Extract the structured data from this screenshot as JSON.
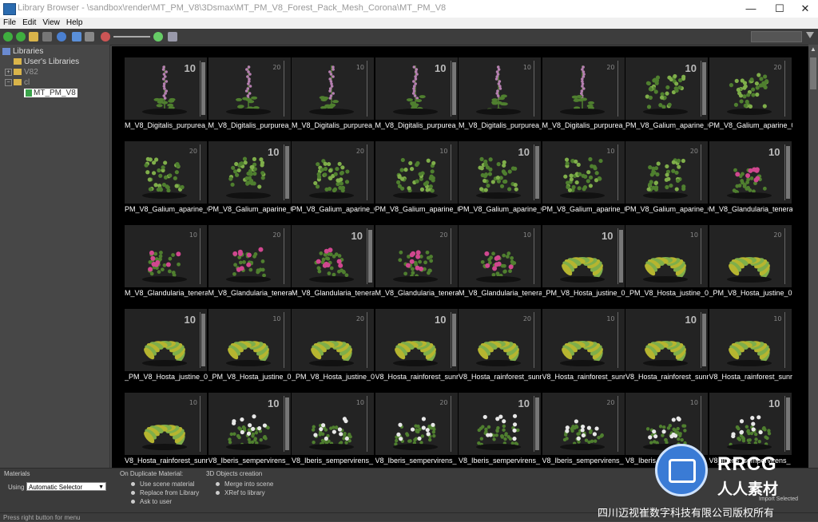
{
  "window": {
    "title": "Library Browser - \\sandbox\\render\\MT_PM_V8\\3Dsmax\\MT_PM_V8_Forest_Pack_Mesh_Corona\\MT_PM_V8",
    "minimize": "—",
    "maximize": "☐",
    "close": "✕"
  },
  "menu": [
    "File",
    "Edit",
    "View",
    "Help"
  ],
  "tree": {
    "root": "Libraries",
    "items": [
      "User's Libraries",
      "V82",
      "cl",
      "MT_PM_V8"
    ]
  },
  "grid": {
    "rows": [
      [
        "M_V8_Digitalis_purpurea_0",
        "M_V8_Digitalis_purpurea_0",
        "M_V8_Digitalis_purpurea_0",
        "M_V8_Digitalis_purpurea_0",
        "M_V8_Digitalis_purpurea_0",
        "M_V8_Digitalis_purpurea_0",
        "PM_V8_Galium_aparine_0",
        "PM_V8_Galium_aparine_0"
      ],
      [
        "PM_V8_Galium_aparine_0",
        "PM_V8_Galium_aparine_0",
        "PM_V8_Galium_aparine_0",
        "PM_V8_Galium_aparine_0",
        "PM_V8_Galium_aparine_0",
        "PM_V8_Galium_aparine_0",
        "PM_V8_Galium_aparine_0",
        "M_V8_Glandularia_tenera_"
      ],
      [
        "M_V8_Glandularia_tenera_",
        "M_V8_Glandularia_tenera_",
        "M_V8_Glandularia_tenera_",
        "M_V8_Glandularia_tenera_",
        "M_V8_Glandularia_tenera_",
        "_PM_V8_Hosta_justine_01",
        "_PM_V8_Hosta_justine_01",
        "_PM_V8_Hosta_justine_01"
      ],
      [
        "_PM_V8_Hosta_justine_01",
        "_PM_V8_Hosta_justine_01",
        "_PM_V8_Hosta_justine_01",
        "V8_Hosta_rainforest_sunris",
        "V8_Hosta_rainforest_sunris",
        "V8_Hosta_rainforest_sunris",
        "V8_Hosta_rainforest_sunris",
        "V8_Hosta_rainforest_sunris"
      ],
      [
        "V8_Hosta_rainforest_sunris",
        "V8_Iberis_sempervirens_",
        "V8_Iberis_sempervirens_",
        "V8_Iberis_sempervirens_",
        "V8_Iberis_sempervirens_",
        "V8_Iberis_sempervirens_",
        "V8_Iberis_sempervirens_",
        "V8_Iberis_sempervirens_"
      ]
    ],
    "ruler_numbers": [
      "10",
      "20"
    ]
  },
  "bottom": {
    "materials_label": "Materials",
    "using_label": "Using",
    "selector_value": "Automatic Selector",
    "duplicate_label": "On Duplicate Material:",
    "duplicate_options": [
      "Use scene material",
      "Replace from Library",
      "Ask to user"
    ],
    "objects_label": "3D Objects creation",
    "objects_options": [
      "Merge into scene",
      "XRef to library"
    ],
    "import_selected": "Import Selected"
  },
  "status": "Press right button for menu",
  "watermark": {
    "brand": "RRCG",
    "brand_sub": "人人素材",
    "copyright": "四川迈视崔数字科技有限公司版权所有"
  },
  "colors": {
    "foxglove": "#b57fb0",
    "leaf": "#4f7f2f",
    "leaf_light": "#7fae4a",
    "hosta": "#b6b530",
    "pink": "#d0478f",
    "white_flower": "#e8e8e8",
    "accent": "#3a7bd5"
  }
}
